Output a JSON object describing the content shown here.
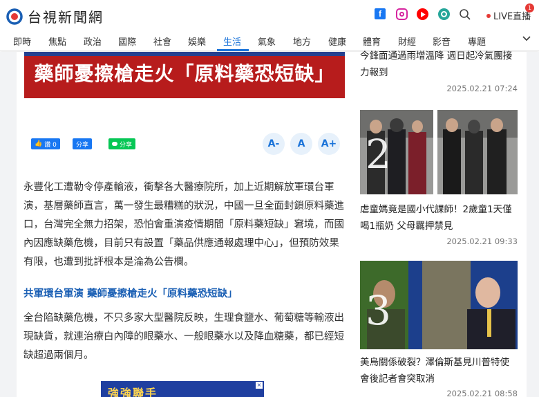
{
  "header": {
    "brand": "台視新聞網",
    "live_label": "LIVE直播",
    "live_badge": "1",
    "social_icons": [
      "facebook-icon",
      "instagram-icon",
      "youtube-icon",
      "line-today-icon"
    ],
    "search_icon": "search-icon"
  },
  "nav": {
    "items": [
      "即時",
      "焦點",
      "政治",
      "國際",
      "社會",
      "娛樂",
      "生活",
      "氣象",
      "地方",
      "健康",
      "體育",
      "財經",
      "影音",
      "專題"
    ],
    "active": "生活",
    "more_icon": "chevron-down-icon"
  },
  "article": {
    "hero_text": "藥師憂擦槍走火「原料藥恐短缺」",
    "share": {
      "like_label": "讚 0",
      "share_label": "分享",
      "line_label": "分享"
    },
    "font_sizes": [
      "A-",
      "A",
      "A+"
    ],
    "para1": "永豐化工遭勒令停產輸液，衝擊各大醫療院所，加上近期解放軍環台軍演，基層藥師直言，萬一發生最糟糕的狀況，中國一旦全面封鎖原料藥進口，台灣完全無力招架，恐怕會重演疫情期間「原料藥短缺」窘境，而國內因應缺藥危機，目前只有設置「藥品供應通報處理中心」，但預防效果有限，也遭到批評根本是淪為公告欄。",
    "subhead": "共軍環台軍演 藥師憂擦槍走火「原料藥恐短缺」",
    "para2": "全台陷缺藥危機，不只多家大型醫院反映，生理食鹽水、葡萄糖等輸液出現缺貨，就連治療白內障的眼藥水、一般眼藥水以及降血糖藥，都已經短缺超過兩個月。",
    "ad_text": "強強聯手"
  },
  "sidebar": {
    "items": [
      {
        "title_line1": "今鋒面通過雨增溫降 週日起冷氣團接",
        "title_line2": "力報到",
        "date": "2025.02.21 07:24"
      },
      {
        "rank": "2",
        "title_line1": "虐童媽竟是國小代課師！2歲童1天僅",
        "title_line2": "喝1瓶奶 父母羈押禁見",
        "date": "2025.02.21 09:33"
      },
      {
        "rank": "3",
        "title_line1": "美烏關係破裂？澤倫斯基見川普特使",
        "title_line2": "會後記者會突取消",
        "date": "2025.02.21 08:58"
      }
    ]
  },
  "colors": {
    "accent": "#1a73d9",
    "hero_red": "#b71c1c",
    "subhead_blue": "#1a5fb4"
  }
}
